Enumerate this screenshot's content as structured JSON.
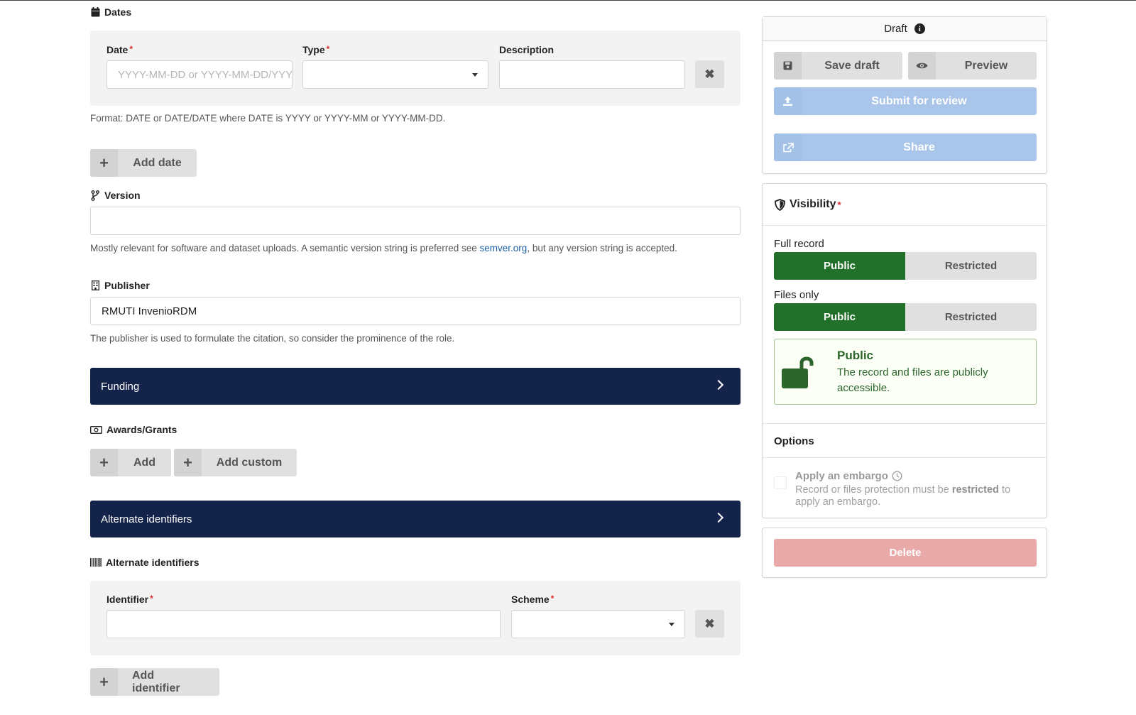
{
  "dates": {
    "section_label": "Dates",
    "date_label": "Date",
    "date_placeholder": "YYYY-MM-DD or YYYY-MM-DD/YYYY-MM-DD",
    "type_label": "Type",
    "type_value": "",
    "description_label": "Description",
    "description_value": "",
    "required_mark": "*",
    "help": "Format: DATE or DATE/DATE where DATE is YYYY or YYYY-MM or YYYY-MM-DD.",
    "add_label": "Add date"
  },
  "version": {
    "section_label": "Version",
    "value": "",
    "help_before": "Mostly relevant for software and dataset uploads. A semantic version string is preferred see ",
    "help_link": "semver.org",
    "help_after": ", but any version string is accepted."
  },
  "publisher": {
    "section_label": "Publisher",
    "value": "RMUTI InvenioRDM",
    "help": "The publisher is used to formulate the citation, so consider the prominence of the role."
  },
  "funding": {
    "accordion_label": "Funding",
    "awards_label": "Awards/Grants",
    "add_label": "Add",
    "add_custom_label": "Add custom"
  },
  "alt_ids": {
    "accordion_label": "Alternate identifiers",
    "section_label": "Alternate identifiers",
    "identifier_label": "Identifier",
    "identifier_value": "",
    "scheme_label": "Scheme",
    "scheme_value": "",
    "add_label": "Add identifier"
  },
  "sidebar": {
    "status": "Draft",
    "save_draft": "Save draft",
    "preview": "Preview",
    "submit": "Submit for review",
    "share": "Share",
    "visibility_title": "Visibility",
    "full_record_label": "Full record",
    "files_only_label": "Files only",
    "public_label": "Public",
    "restricted_label": "Restricted",
    "msg_title": "Public",
    "msg_body": "The record and files are publicly accessible.",
    "options_label": "Options",
    "embargo_title": "Apply an embargo",
    "embargo_desc_before": "Record or files protection must be ",
    "embargo_desc_bold": "restricted",
    "embargo_desc_after": " to apply an embargo.",
    "delete": "Delete",
    "info_icon_char": "i"
  },
  "colors": {
    "accordion": "#13234a",
    "public_green": "#22702a",
    "submit_blue": "#a9c6ea",
    "delete_red": "#e8a9a8",
    "link": "#1d5fa6"
  }
}
